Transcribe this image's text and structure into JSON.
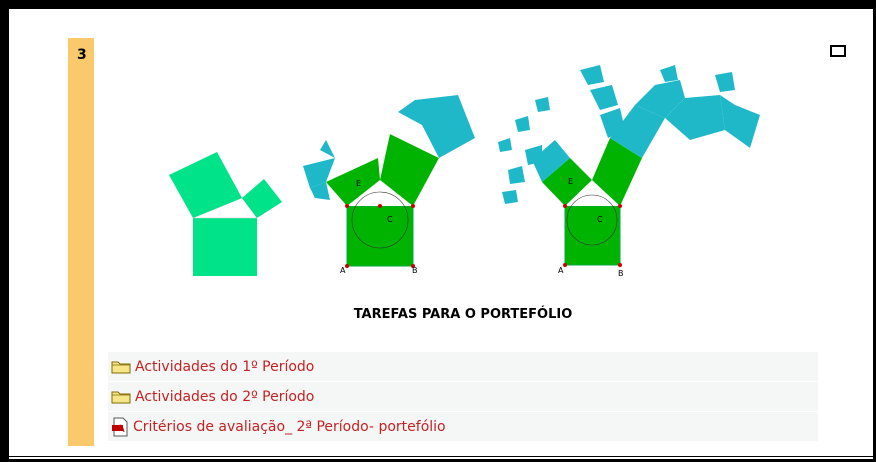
{
  "section": {
    "number": "3"
  },
  "caption": "TAREFAS PARA O PORTEFÓLIO",
  "figure_labels": {
    "a1": "A",
    "b1": "B",
    "e1": "E",
    "c1": "C",
    "a2": "A",
    "b2": "B",
    "e2": "E",
    "c2": "C"
  },
  "resources": [
    {
      "label": "Actividades do 1º Período",
      "icon": "folder-icon"
    },
    {
      "label": "Actividades do 2º Período",
      "icon": "folder-icon"
    },
    {
      "label": "Critérios de avaliação_ 2ª Período- portefólio",
      "icon": "pdf-icon"
    }
  ],
  "colors": {
    "section_bar": "#f9c96b",
    "link": "#c32222",
    "light_green": "#00e388",
    "green": "#00b300",
    "teal": "#1fb8c8"
  }
}
